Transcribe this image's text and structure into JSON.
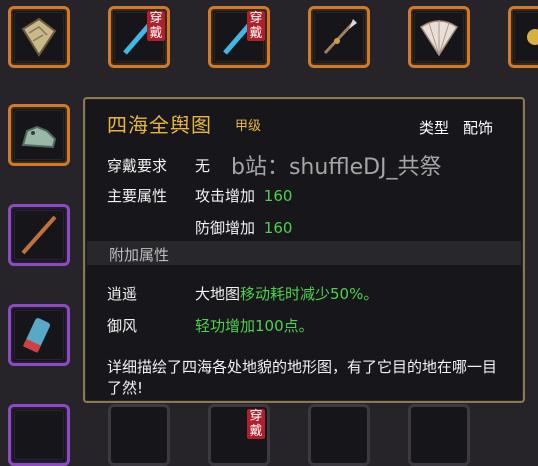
{
  "inventory": {
    "equipped_tag": "穿戴",
    "slots": [
      {
        "icon": "map-scroll-icon"
      },
      {
        "icon": "blue-staff-icon"
      },
      {
        "icon": "blue-staff-icon"
      },
      {
        "icon": "spear-icon"
      },
      {
        "icon": "folding-fan-icon"
      },
      {
        "icon": "gold-trinket-icon"
      },
      {
        "icon": "stone-lion-icon"
      },
      {
        "icon": "wooden-staff-icon"
      },
      {
        "icon": "jade-scroll-icon"
      }
    ]
  },
  "tooltip": {
    "title": "四海全舆图",
    "grade": "甲级",
    "type_label": "类型",
    "type_value": "配饰",
    "watermark": "b站：shuffleDJ_共祭",
    "requirement_label": "穿戴要求",
    "requirement_value": "无",
    "main_attr_label": "主要属性",
    "main_attrs": [
      {
        "name": "攻击增加",
        "value": "160"
      },
      {
        "name": "防御增加",
        "value": "160"
      }
    ],
    "extra_section": "附加属性",
    "extra_attrs": [
      {
        "label": "逍遥",
        "prefix": "大地图",
        "effect": "移动耗时减少50%。"
      },
      {
        "label": "御风",
        "prefix": "",
        "effect": "轻功增加100点。"
      }
    ],
    "description": "详细描绘了四海各处地貌的地形图，有了它目的地在哪一目了然!"
  },
  "colors": {
    "title_gold": "#e8b640",
    "value_green": "#4fd04f",
    "rarity_orange": "#d07a2a",
    "rarity_purple": "#8a4cc0",
    "equipped_red": "#b0202a"
  }
}
